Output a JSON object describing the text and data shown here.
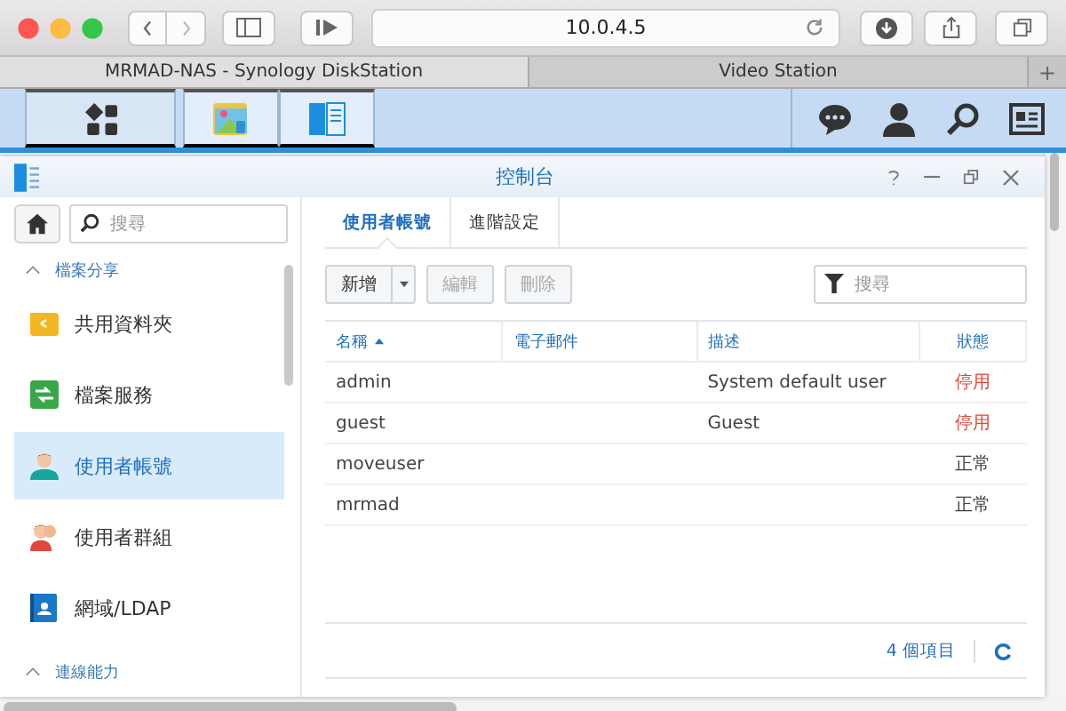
{
  "browser": {
    "address": "10.0.4.5",
    "tabs": [
      {
        "label": "MRMAD-NAS - Synology DiskStation",
        "selected": true
      },
      {
        "label": "Video Station",
        "selected": false
      }
    ],
    "new_tab": "+"
  },
  "window": {
    "title": "控制台"
  },
  "sidebar": {
    "search": {
      "placeholder": "搜尋"
    },
    "sections": [
      {
        "label": "檔案分享",
        "expanded": true,
        "items": [
          {
            "label": "共用資料夾",
            "kind": "folder",
            "selected": false
          },
          {
            "label": "檔案服務",
            "kind": "service",
            "selected": false
          },
          {
            "label": "使用者帳號",
            "kind": "user",
            "selected": true
          },
          {
            "label": "使用者群組",
            "kind": "group",
            "selected": false
          },
          {
            "label": "網域/LDAP",
            "kind": "directory",
            "selected": false
          }
        ]
      },
      {
        "label": "連線能力",
        "expanded": true
      }
    ]
  },
  "tabs": [
    {
      "label": "使用者帳號",
      "selected": true
    },
    {
      "label": "進階設定",
      "selected": false
    }
  ],
  "toolbar": {
    "buttons": [
      {
        "label": "新增",
        "disabled": false,
        "dropdown": true
      },
      {
        "label": "編輯",
        "disabled": true,
        "dropdown": false
      },
      {
        "label": "刪除",
        "disabled": true,
        "dropdown": false
      }
    ],
    "filter": {
      "placeholder": "搜尋"
    }
  },
  "table": {
    "columns": [
      {
        "label": "名稱",
        "sorted": true
      },
      {
        "label": "電子郵件",
        "sorted": false
      },
      {
        "label": "描述",
        "sorted": false
      },
      {
        "label": "狀態",
        "sorted": false
      }
    ],
    "rows": [
      {
        "name": "admin",
        "description": "System default user",
        "status": "停用",
        "kind": "disabled"
      },
      {
        "name": "guest",
        "description": "Guest",
        "status": "停用",
        "kind": "disabled"
      },
      {
        "name": "moveuser",
        "status": "正常",
        "kind": "normal"
      },
      {
        "name": "mrmad",
        "status": "正常",
        "kind": "normal"
      }
    ]
  },
  "footer": {
    "count": "4 個項目"
  }
}
